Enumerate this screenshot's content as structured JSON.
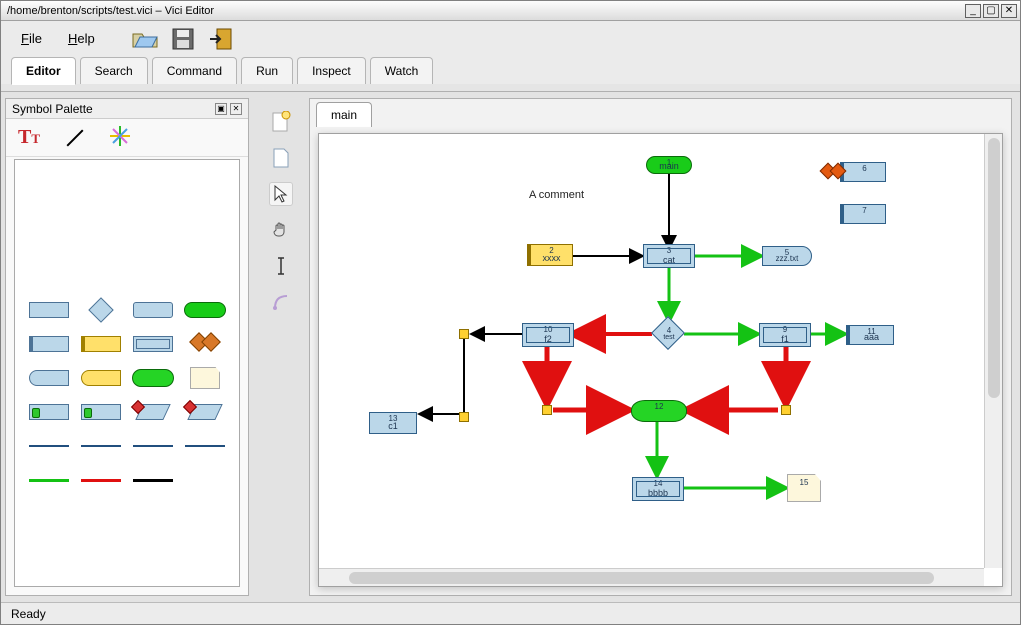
{
  "title": "/home/brenton/scripts/test.vici – Vici Editor",
  "menu": {
    "file": "File",
    "help": "Help"
  },
  "tabs": [
    "Editor",
    "Search",
    "Command",
    "Run",
    "Inspect",
    "Watch"
  ],
  "active_tab": 0,
  "left_panel": {
    "title": "Symbol Palette"
  },
  "doc_tabs": [
    "main"
  ],
  "status": "Ready",
  "comment": "A comment",
  "nodes": {
    "main": {
      "id": "1",
      "label": "main"
    },
    "xxxx": {
      "id": "2",
      "label": "xxxx"
    },
    "cat": {
      "id": "3",
      "label": "cat"
    },
    "diamond": {
      "id": "4",
      "label": "test"
    },
    "c1": {
      "id": "13",
      "label": "c1"
    },
    "f2": {
      "id": "10",
      "label": "f2"
    },
    "f1": {
      "id": "9",
      "label": "f1"
    },
    "aaa": {
      "id": "11",
      "label": "aaa"
    },
    "zzz": {
      "id": "5",
      "label": "zzz.txt"
    },
    "cyl": {
      "id": "12",
      "label": ""
    },
    "bbbb": {
      "id": "14",
      "label": "bbbb"
    },
    "note": {
      "id": "15",
      "label": ""
    },
    "top1": {
      "id": "6",
      "label": ""
    },
    "top2": {
      "id": "7",
      "label": ""
    }
  }
}
